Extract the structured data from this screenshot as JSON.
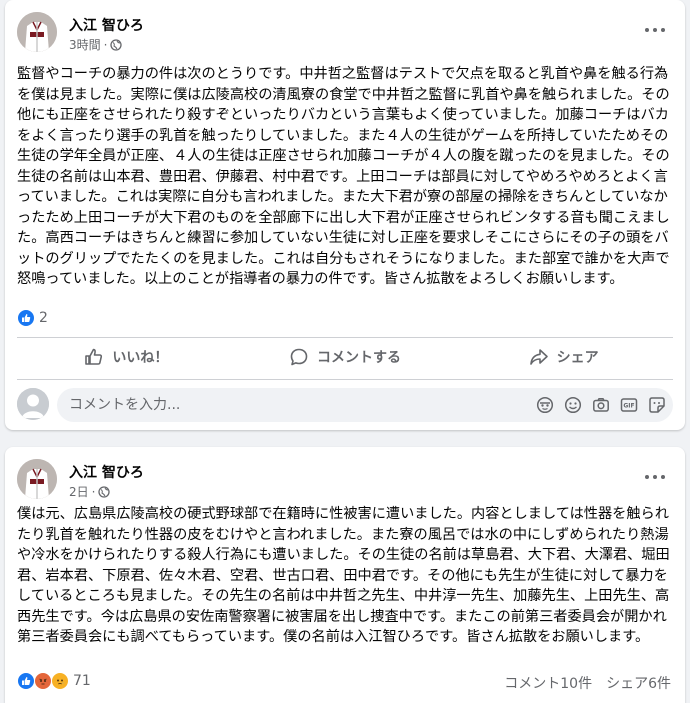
{
  "posts": [
    {
      "author": "入江 智ひろ",
      "time": "3時間",
      "dot": "·",
      "body": "監督やコーチの暴力の件は次のとうりです。中井哲之監督はテストで欠点を取ると乳首や鼻を触る行為を僕は見ました。実際に僕は広陵高校の清風寮の食堂で中井哲之監督に乳首や鼻を触られました。その他にも正座をさせられたり殺すぞといったりバカという言葉もよく使っていました。加藤コーチはバカをよく言ったり選手の乳首を触ったりしていました。また４人の生徒がゲームを所持していたためその生徒の学年全員が正座、４人の生徒は正座させられ加藤コーチが４人の腹を蹴ったのを見ました。その生徒の名前は山本君、豊田君、伊藤君、村中君です。上田コーチは部員に対してやめろやめろとよく言っていました。これは実際に自分も言われました。また大下君が寮の部屋の掃除をきちんとしていなかったため上田コーチが大下君のものを全部廊下に出し大下君が正座させられビンタする音も聞こえました。高西コーチはきちんと練習に参加していない生徒に対し正座を要求しそこにさらにその子の頭をバットのグリップでたたくのを見ました。これは自分もされそうになりました。また部室で誰かを大声で怒鳴っていました。以上のことが指導者の暴力の件です。皆さん拡散をよろしくお願いします。",
      "reaction_count": "2",
      "actions": {
        "like": "いいね！",
        "comment": "コメントする",
        "share": "シェア"
      },
      "comment_placeholder": "コメントを入力..."
    },
    {
      "author": "入江 智ひろ",
      "time": "2日",
      "dot": "·",
      "body": "僕は元、広島県広陵高校の硬式野球部で在籍時に性被害に遭いました。内容としましては性器を触られたり乳首を触れたり性器の皮をむけやと言われました。また寮の風呂では水の中にしずめられたり熱湯や冷水をかけられたりする殺人行為にも遭いました。その生徒の名前は草島君、大下君、大澤君、堀田君、岩本君、下原君、佐々木君、空君、世古口君、田中君です。その他にも先生が生徒に対して暴力をしているところも見ました。その先生の名前は中井哲之先生、中井淳一先生、加藤先生、上田先生、高西先生です。今は広島県の安佐南警察署に被害届を出し捜査中です。またこの前第三者委員会が開かれ第三者委員会にも調べてもらっています。僕の名前は入江智ひろです。皆さん拡散をお願いします。",
      "reaction_count": "71",
      "comment_count": "コメント10件",
      "share_count": "シェア6件"
    }
  ],
  "colors": {
    "accent": "#1877f2",
    "secondary_text": "#65676b",
    "background": "#f0f2f5"
  },
  "icons": {
    "avatar": "baseball-uniform-avatar",
    "privacy": "globe-icon",
    "more": "more-options-icon",
    "like": "thumbs-up-icon",
    "comment": "speech-bubble-icon",
    "share": "share-arrow-icon",
    "comment_tools": [
      "avatar-sticker-icon",
      "emoji-icon",
      "camera-icon",
      "gif-icon",
      "sticker-icon"
    ]
  }
}
